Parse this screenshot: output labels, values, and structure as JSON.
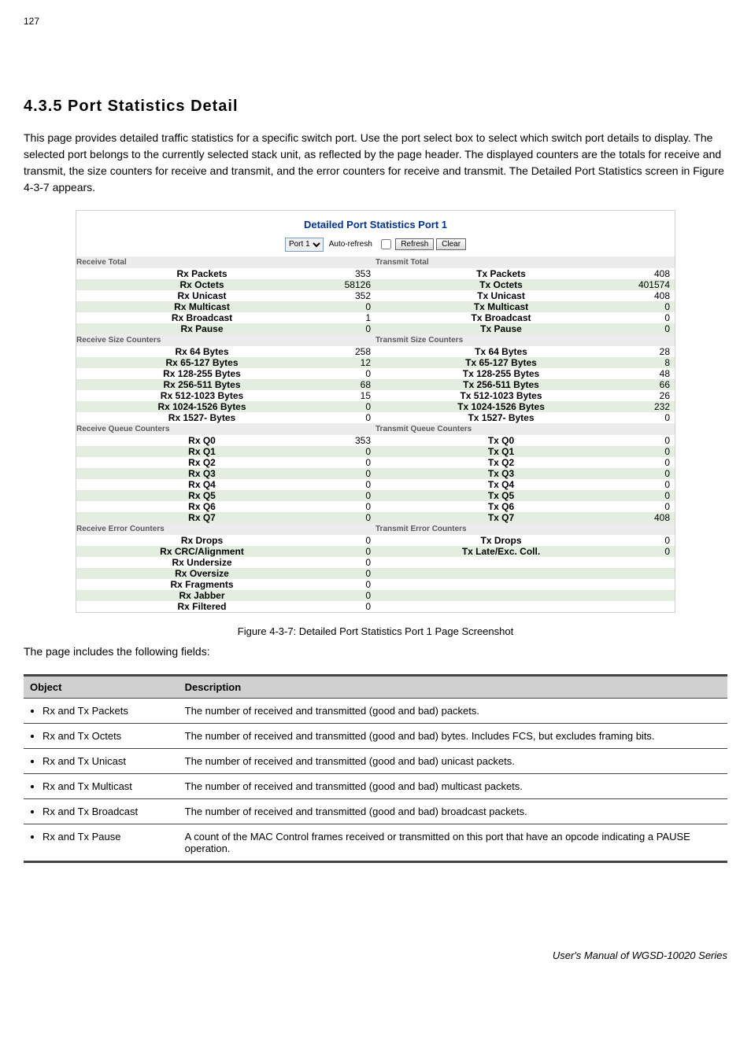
{
  "page": {
    "number": "127",
    "header_text": "This page provides detailed traffic statistics for a specific switch port. Use the port select box to select which switch port details to display. The selected port belongs to the currently selected stack unit, as reflected by the page header. The displayed counters are the totals for receive and transmit, the size counters for receive and transmit, and the error counters for receive and transmit. The Detailed Port Statistics screen in Figure 4-3-7 appears.",
    "figure_caption": "Figure 4-3-7: Detailed Port Statistics Port 1 Page Screenshot",
    "table_intro": "The page includes the following fields:",
    "footer_tag": "User's Manual of WGSD-10020 Series"
  },
  "section": {
    "title": "4.3.5 Port Statistics Detail"
  },
  "panel": {
    "title": "Detailed Port Statistics  Port 1",
    "port_label": "Port 1",
    "autorefresh_label": "Auto-refresh",
    "refresh_label": "Refresh",
    "clear_label": "Clear"
  },
  "headers": {
    "rx_total": "Receive Total",
    "tx_total": "Transmit Total",
    "rx_size": "Receive Size Counters",
    "tx_size": "Transmit Size Counters",
    "rx_queue": "Receive Queue Counters",
    "tx_queue": "Transmit Queue Counters",
    "rx_error": "Receive Error Counters",
    "tx_error": "Transmit Error Counters"
  },
  "total": {
    "rows": [
      {
        "rx_l": "Rx Packets",
        "rx_v": "353",
        "tx_l": "Tx Packets",
        "tx_v": "408",
        "alt": false
      },
      {
        "rx_l": "Rx Octets",
        "rx_v": "58126",
        "tx_l": "Tx Octets",
        "tx_v": "401574",
        "alt": true
      },
      {
        "rx_l": "Rx Unicast",
        "rx_v": "352",
        "tx_l": "Tx Unicast",
        "tx_v": "408",
        "alt": false
      },
      {
        "rx_l": "Rx Multicast",
        "rx_v": "0",
        "tx_l": "Tx Multicast",
        "tx_v": "0",
        "alt": true
      },
      {
        "rx_l": "Rx Broadcast",
        "rx_v": "1",
        "tx_l": "Tx Broadcast",
        "tx_v": "0",
        "alt": false
      },
      {
        "rx_l": "Rx Pause",
        "rx_v": "0",
        "tx_l": "Tx Pause",
        "tx_v": "0",
        "alt": true
      }
    ]
  },
  "size": {
    "rows": [
      {
        "rx_l": "Rx 64 Bytes",
        "rx_v": "258",
        "tx_l": "Tx 64 Bytes",
        "tx_v": "28",
        "alt": false
      },
      {
        "rx_l": "Rx 65-127 Bytes",
        "rx_v": "12",
        "tx_l": "Tx 65-127 Bytes",
        "tx_v": "8",
        "alt": true
      },
      {
        "rx_l": "Rx 128-255 Bytes",
        "rx_v": "0",
        "tx_l": "Tx 128-255 Bytes",
        "tx_v": "48",
        "alt": false
      },
      {
        "rx_l": "Rx 256-511 Bytes",
        "rx_v": "68",
        "tx_l": "Tx 256-511 Bytes",
        "tx_v": "66",
        "alt": true
      },
      {
        "rx_l": "Rx 512-1023 Bytes",
        "rx_v": "15",
        "tx_l": "Tx 512-1023 Bytes",
        "tx_v": "26",
        "alt": false
      },
      {
        "rx_l": "Rx 1024-1526 Bytes",
        "rx_v": "0",
        "tx_l": "Tx 1024-1526 Bytes",
        "tx_v": "232",
        "alt": true
      },
      {
        "rx_l": "Rx 1527- Bytes",
        "rx_v": "0",
        "tx_l": "Tx 1527- Bytes",
        "tx_v": "0",
        "alt": false
      }
    ]
  },
  "queue": {
    "rows": [
      {
        "rx_l": "Rx Q0",
        "rx_v": "353",
        "tx_l": "Tx Q0",
        "tx_v": "0",
        "alt": false
      },
      {
        "rx_l": "Rx Q1",
        "rx_v": "0",
        "tx_l": "Tx Q1",
        "tx_v": "0",
        "alt": true
      },
      {
        "rx_l": "Rx Q2",
        "rx_v": "0",
        "tx_l": "Tx Q2",
        "tx_v": "0",
        "alt": false
      },
      {
        "rx_l": "Rx Q3",
        "rx_v": "0",
        "tx_l": "Tx Q3",
        "tx_v": "0",
        "alt": true
      },
      {
        "rx_l": "Rx Q4",
        "rx_v": "0",
        "tx_l": "Tx Q4",
        "tx_v": "0",
        "alt": false
      },
      {
        "rx_l": "Rx Q5",
        "rx_v": "0",
        "tx_l": "Tx Q5",
        "tx_v": "0",
        "alt": true
      },
      {
        "rx_l": "Rx Q6",
        "rx_v": "0",
        "tx_l": "Tx Q6",
        "tx_v": "0",
        "alt": false
      },
      {
        "rx_l": "Rx Q7",
        "rx_v": "0",
        "tx_l": "Tx Q7",
        "tx_v": "408",
        "alt": true
      }
    ]
  },
  "error": {
    "rows": [
      {
        "rx_l": "Rx Drops",
        "rx_v": "0",
        "tx_l": "Tx Drops",
        "tx_v": "0",
        "alt": false
      },
      {
        "rx_l": "Rx CRC/Alignment",
        "rx_v": "0",
        "tx_l": "Tx Late/Exc. Coll.",
        "tx_v": "0",
        "alt": true
      },
      {
        "rx_l": "Rx Undersize",
        "rx_v": "0",
        "tx_l": "",
        "tx_v": "",
        "alt": false
      },
      {
        "rx_l": "Rx Oversize",
        "rx_v": "0",
        "tx_l": "",
        "tx_v": "",
        "alt": true
      },
      {
        "rx_l": "Rx Fragments",
        "rx_v": "0",
        "tx_l": "",
        "tx_v": "",
        "alt": false
      },
      {
        "rx_l": "Rx Jabber",
        "rx_v": "0",
        "tx_l": "",
        "tx_v": "",
        "alt": true
      },
      {
        "rx_l": "Rx Filtered",
        "rx_v": "0",
        "tx_l": "",
        "tx_v": "",
        "alt": false
      }
    ]
  },
  "desc": {
    "head_obj": "Object",
    "head_desc": "Description",
    "rows": [
      {
        "obj": "Rx and Tx Packets",
        "desc": "The number of received and transmitted (good and bad) packets."
      },
      {
        "obj": "Rx and Tx Octets",
        "desc": "The number of received and transmitted (good and bad) bytes. Includes FCS, but excludes framing bits."
      },
      {
        "obj": "Rx and Tx Unicast",
        "desc": "The number of received and transmitted (good and bad) unicast packets."
      },
      {
        "obj": "Rx and Tx Multicast",
        "desc": "The number of received and transmitted (good and bad) multicast packets."
      },
      {
        "obj": "Rx and Tx Broadcast",
        "desc": "The number of received and transmitted (good and bad) broadcast packets."
      },
      {
        "obj": "Rx and Tx Pause",
        "desc": "A count of the MAC Control frames received or transmitted on this port that have an opcode indicating a PAUSE operation."
      }
    ]
  }
}
